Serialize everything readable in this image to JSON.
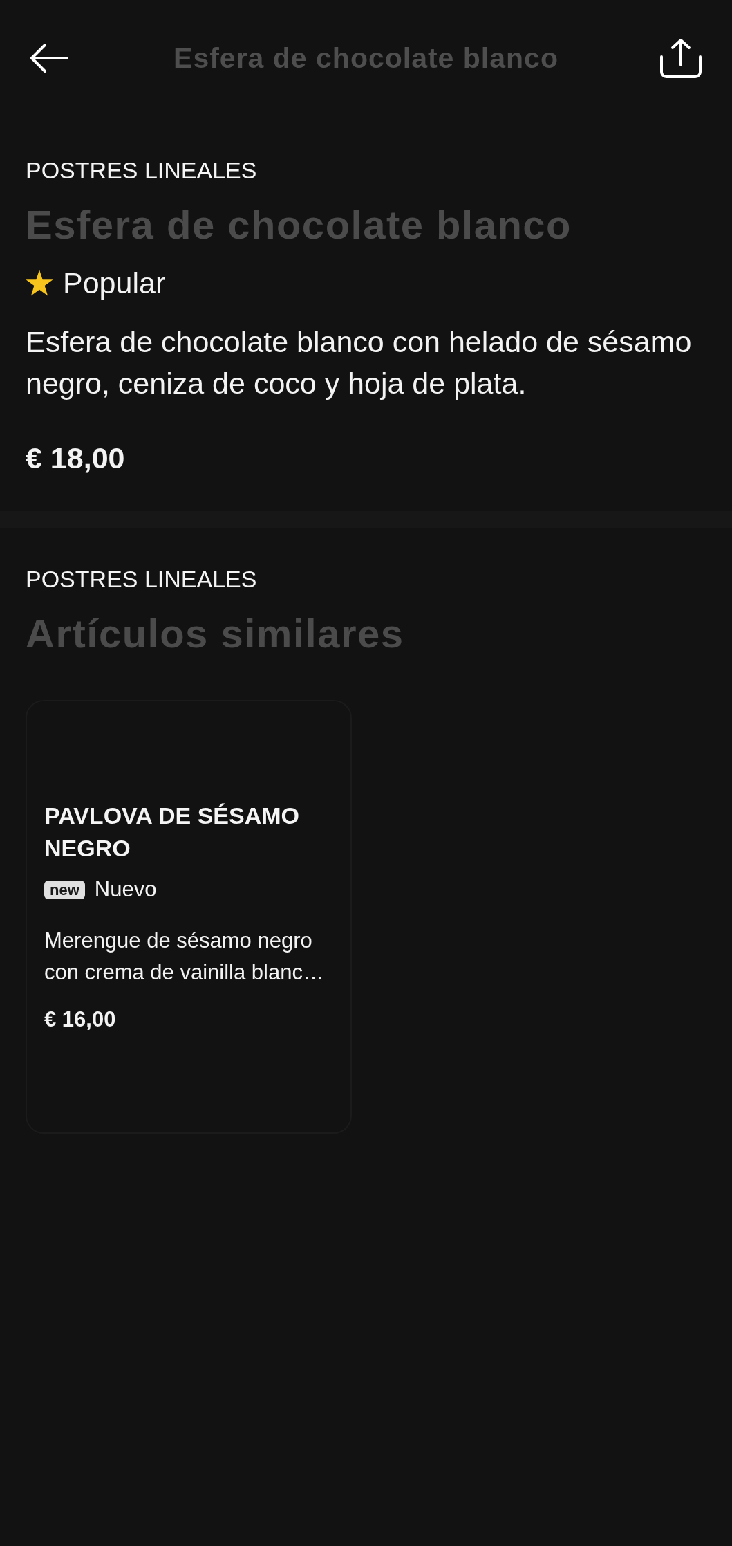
{
  "header": {
    "title": "Esfera de chocolate blanco"
  },
  "product": {
    "category": "POSTRES LINEALES",
    "name": "Esfera de chocolate blanco",
    "tags": [
      {
        "kind": "star",
        "label": "Popular"
      }
    ],
    "description": "Esfera de chocolate blanco con helado de sésamo negro, ceniza de coco y hoja de plata.",
    "price": "€ 18,00"
  },
  "similar": {
    "category": "POSTRES LINEALES",
    "title": "Artículos similares",
    "items": [
      {
        "name": "PAVLOVA DE SÉSAMO NEGRO",
        "tags": [
          {
            "kind": "new",
            "badge": "new",
            "label": "Nuevo"
          }
        ],
        "description": "Merengue de sésamo negro con crema de vainilla blanc…",
        "price": "€ 16,00"
      }
    ]
  }
}
